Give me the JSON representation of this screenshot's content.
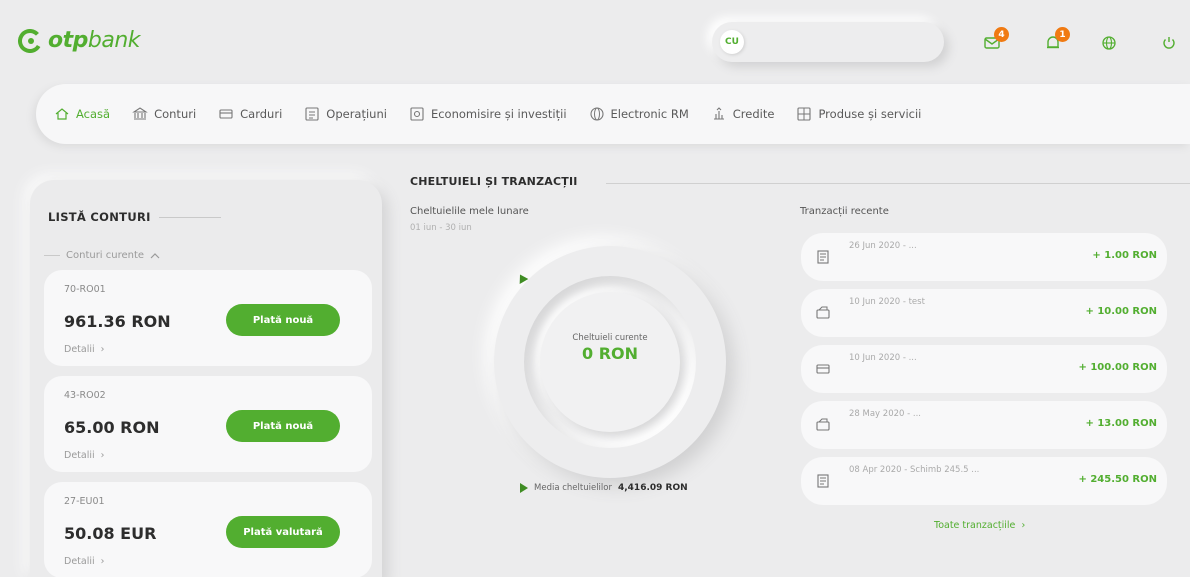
{
  "brand": {
    "name_bold": "otp",
    "name_rest": "bank",
    "color": "#52ae30"
  },
  "header": {
    "avatar_initials": "CU",
    "search_placeholder": "",
    "messages_badge": "4",
    "notifications_badge": "1",
    "icons": [
      "mail-icon",
      "bell-icon",
      "globe-icon",
      "power-icon"
    ]
  },
  "nav": [
    {
      "label": "Acasă",
      "icon": "home-icon",
      "active": true
    },
    {
      "label": "Conturi",
      "icon": "bank-icon",
      "active": false
    },
    {
      "label": "Carduri",
      "icon": "card-icon",
      "active": false
    },
    {
      "label": "Operațiuni",
      "icon": "operations-icon",
      "active": false
    },
    {
      "label": "Economisire și investiții",
      "icon": "savings-icon",
      "active": false
    },
    {
      "label": "Electronic RM",
      "icon": "globe-icon",
      "active": false
    },
    {
      "label": "Credite",
      "icon": "credit-icon",
      "active": false
    },
    {
      "label": "Produse și servicii",
      "icon": "products-icon",
      "active": false
    }
  ],
  "accounts": {
    "title": "LISTĂ CONTURI",
    "subtitle": "Conturi curente",
    "items": [
      {
        "iban": "70-RO01",
        "amount": "961.36 RON",
        "button": "Plată nouă",
        "detail": "Detalii"
      },
      {
        "iban": "43-RO02",
        "amount": "65.00 RON",
        "button": "Plată nouă",
        "detail": "Detalii"
      },
      {
        "iban": "27-EU01",
        "amount": "50.08 EUR",
        "button": "Plată valutară",
        "detail": "Detalii"
      }
    ]
  },
  "spending": {
    "section_title": "CHELTUIELI ȘI TRANZACȚII",
    "monthly_label": "Cheltuielile mele lunare",
    "monthly_range": "01 iun - 30 iun",
    "current_label": "Cheltuieli curente",
    "current_value": "0 RON",
    "average_label": "Media cheltuielilor",
    "average_value": "4,416.09 RON"
  },
  "transactions": {
    "title": "Tranzacții recente",
    "all_link": "Toate tranzacțiile",
    "items": [
      {
        "desc": "26 Jun 2020 - ...",
        "amount": "+ 1.00 RON",
        "icon": "receipt-icon"
      },
      {
        "desc": "10 Jun 2020 - test",
        "amount": "+ 10.00 RON",
        "icon": "transfer-icon"
      },
      {
        "desc": "10 Jun 2020 - ...",
        "amount": "+ 100.00 RON",
        "icon": "card-icon"
      },
      {
        "desc": "28 May 2020 - ...",
        "amount": "+ 13.00 RON",
        "icon": "transfer-icon"
      },
      {
        "desc": "08 Apr 2020 - Schimb 245.5 ...",
        "amount": "+ 245.50 RON",
        "icon": "receipt-icon"
      }
    ]
  }
}
